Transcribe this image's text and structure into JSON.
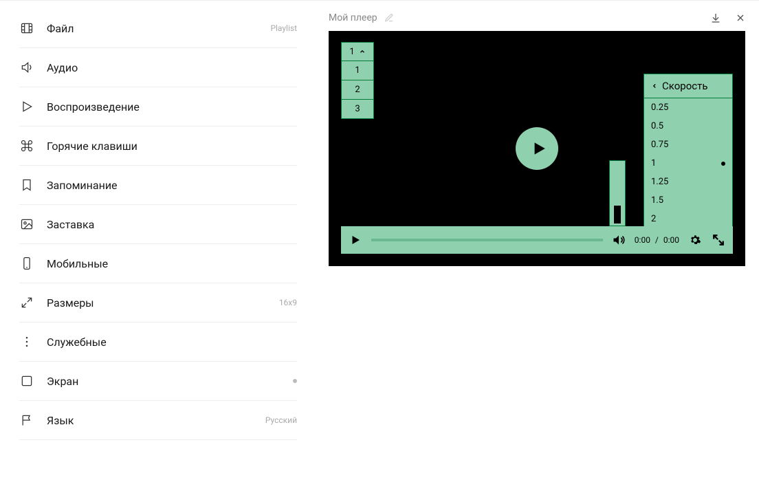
{
  "title": "Мой плеер",
  "sidebar": [
    {
      "key": "file",
      "label": "Файл",
      "meta": "Playlist",
      "icon": "film"
    },
    {
      "key": "audio",
      "label": "Аудио",
      "meta": "",
      "icon": "speaker"
    },
    {
      "key": "playback",
      "label": "Воспроизведение",
      "meta": "",
      "icon": "play"
    },
    {
      "key": "hotkeys",
      "label": "Горячие клавиши",
      "meta": "",
      "icon": "command"
    },
    {
      "key": "remember",
      "label": "Запоминание",
      "meta": "",
      "icon": "bookmark"
    },
    {
      "key": "splash",
      "label": "Заставка",
      "meta": "",
      "icon": "image"
    },
    {
      "key": "mobile",
      "label": "Мобильные",
      "meta": "",
      "icon": "phone"
    },
    {
      "key": "sizes",
      "label": "Размеры",
      "meta": "16x9",
      "icon": "expand"
    },
    {
      "key": "service",
      "label": "Служебные",
      "meta": "",
      "icon": "dots-v"
    },
    {
      "key": "screen",
      "label": "Экран",
      "meta": "dot",
      "icon": "square"
    },
    {
      "key": "lang",
      "label": "Язык",
      "meta": "Русский",
      "icon": "flag"
    }
  ],
  "playlist": {
    "current": "1",
    "options": [
      "1",
      "2",
      "3"
    ]
  },
  "speed": {
    "title": "Скорость",
    "current": "1",
    "options": [
      "0.25",
      "0.5",
      "0.75",
      "1",
      "1.25",
      "1.5",
      "2"
    ]
  },
  "time": {
    "current": "0:00",
    "separator": "/",
    "total": "0:00"
  },
  "accent_color": "#8fd1ae"
}
